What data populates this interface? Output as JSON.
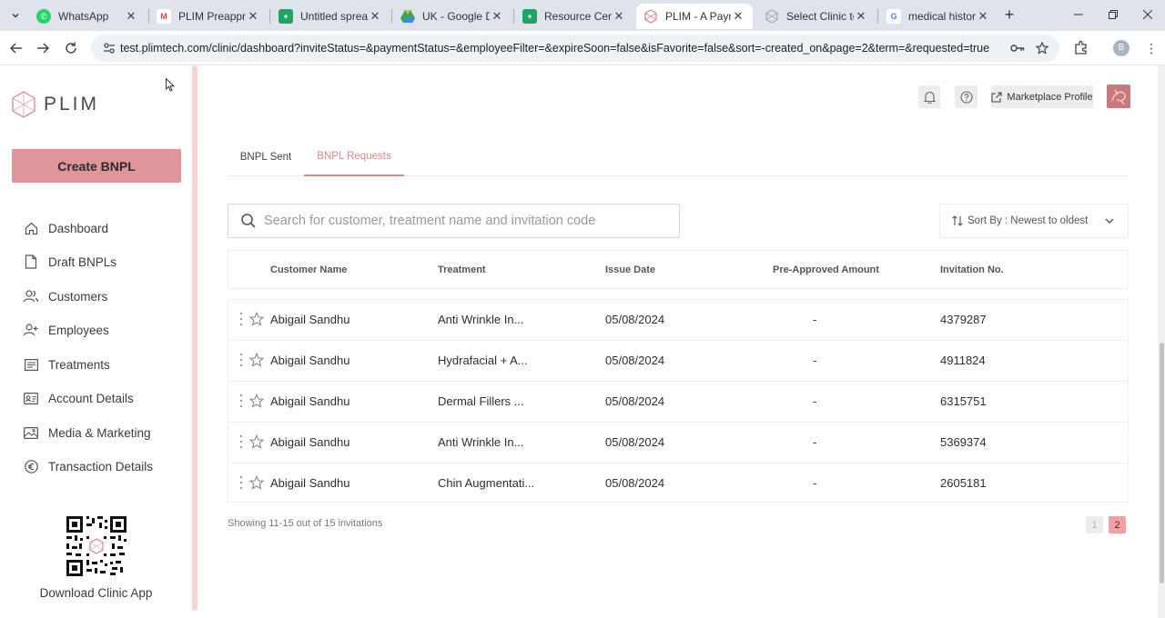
{
  "browser": {
    "tabs": [
      {
        "title": "WhatsApp",
        "favicon": "whatsapp-icon",
        "color": "#25d366"
      },
      {
        "title": "PLIM Preapproval",
        "favicon": "gmail-icon",
        "color": "#ea4335"
      },
      {
        "title": "Untitled spreadsheet",
        "favicon": "sheets-icon",
        "color": "#1fa463"
      },
      {
        "title": "UK - Google Drive",
        "favicon": "drive-icon",
        "color": "#4285f4"
      },
      {
        "title": "Resource Centre",
        "favicon": "sheets-icon",
        "color": "#1fa463"
      },
      {
        "title": "PLIM - A Payment",
        "favicon": "plim-icon",
        "color": "#d28a8f"
      },
      {
        "title": "Select Clinic to c",
        "favicon": "plim-icon",
        "color": "#b0b0b0"
      },
      {
        "title": "medical history c",
        "favicon": "google-icon",
        "color": "#4285f4"
      }
    ],
    "url": "test.plimtech.com/clinic/dashboard?inviteStatus=&paymentStatus=&employeeFilter=&expireSoon=false&isFavorite=false&sort=-created_on&page=2&term=&requested=true",
    "profile_initial": "B"
  },
  "sidebar": {
    "logo_text": "PLIM",
    "create_button": "Create BNPL",
    "items": [
      {
        "label": "Dashboard",
        "icon": "home-icon"
      },
      {
        "label": "Draft BNPLs",
        "icon": "document-icon"
      },
      {
        "label": "Customers",
        "icon": "users-icon"
      },
      {
        "label": "Employees",
        "icon": "user-plus-icon"
      },
      {
        "label": "Treatments",
        "icon": "list-icon"
      },
      {
        "label": "Account Details",
        "icon": "id-card-icon"
      },
      {
        "label": "Media & Marketing",
        "icon": "image-icon"
      },
      {
        "label": "Transaction Details",
        "icon": "euro-icon"
      }
    ],
    "download_label": "Download Clinic App"
  },
  "header": {
    "marketplace_label": "Marketplace Profile"
  },
  "tabs": [
    {
      "label": "BNPL Sent",
      "active": false
    },
    {
      "label": "BNPL Requests",
      "active": true
    }
  ],
  "search": {
    "placeholder": "Search for customer, treatment name and invitation code",
    "value": ""
  },
  "sort": {
    "label": "Sort By : Newest to oldest"
  },
  "table": {
    "columns": [
      "Customer Name",
      "Treatment",
      "Issue Date",
      "Pre-Approved Amount",
      "Invitation No."
    ],
    "rows": [
      {
        "customer": "Abigail Sandhu",
        "treatment": "Anti Wrinkle In...",
        "date": "05/08/2024",
        "amount": "-",
        "invitation": "4379287"
      },
      {
        "customer": "Abigail Sandhu",
        "treatment": "Hydrafacial + A...",
        "date": "05/08/2024",
        "amount": "-",
        "invitation": "4911824"
      },
      {
        "customer": "Abigail Sandhu",
        "treatment": "Dermal Fillers ...",
        "date": "05/08/2024",
        "amount": "-",
        "invitation": "6315751"
      },
      {
        "customer": "Abigail Sandhu",
        "treatment": "Anti Wrinkle In...",
        "date": "05/08/2024",
        "amount": "-",
        "invitation": "5369374"
      },
      {
        "customer": "Abigail Sandhu",
        "treatment": "Chin Augmentati...",
        "date": "05/08/2024",
        "amount": "-",
        "invitation": "2605181"
      }
    ]
  },
  "pagination": {
    "showing": "Showing 11-15 out of 15 invitations",
    "pages": [
      "1",
      "2"
    ],
    "current": "2"
  },
  "colors": {
    "accent": "#d28a8f",
    "create_button": "#e0959a",
    "active_page": "#f2a0a4"
  }
}
